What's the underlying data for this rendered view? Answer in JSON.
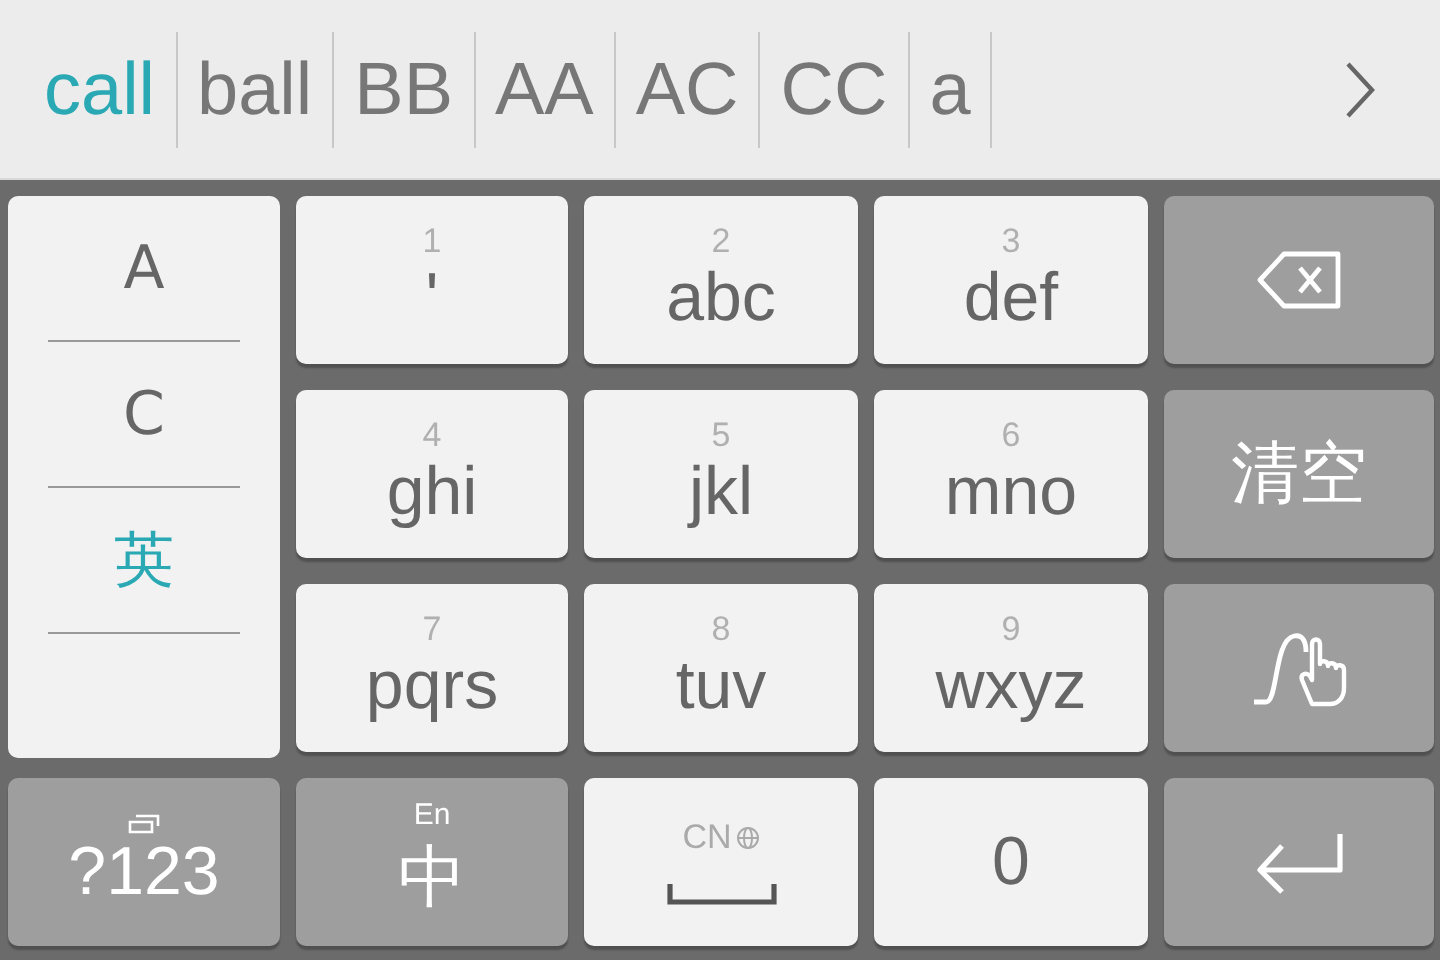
{
  "candidates": [
    {
      "text": "call",
      "selected": true
    },
    {
      "text": "ball",
      "selected": false
    },
    {
      "text": "BB",
      "selected": false
    },
    {
      "text": "AA",
      "selected": false
    },
    {
      "text": "AC",
      "selected": false
    },
    {
      "text": "CC",
      "selected": false
    },
    {
      "text": "a",
      "selected": false
    }
  ],
  "side_panel": [
    {
      "label": "A",
      "selected": false
    },
    {
      "label": "C",
      "selected": false
    },
    {
      "label": "英",
      "selected": true
    }
  ],
  "keys": [
    {
      "kind": "digit",
      "hint": "1",
      "label": "'"
    },
    {
      "kind": "digit",
      "hint": "2",
      "label": "abc"
    },
    {
      "kind": "digit",
      "hint": "3",
      "label": "def"
    },
    {
      "kind": "backspace"
    },
    {
      "kind": "digit",
      "hint": "4",
      "label": "ghi"
    },
    {
      "kind": "digit",
      "hint": "5",
      "label": "jkl"
    },
    {
      "kind": "digit",
      "hint": "6",
      "label": "mno"
    },
    {
      "kind": "clear",
      "label": "清空"
    },
    {
      "kind": "digit",
      "hint": "7",
      "label": "pqrs"
    },
    {
      "kind": "digit",
      "hint": "8",
      "label": "tuv"
    },
    {
      "kind": "digit",
      "hint": "9",
      "label": "wxyz"
    },
    {
      "kind": "gesture"
    },
    {
      "kind": "symbols",
      "label": "?123"
    },
    {
      "kind": "language",
      "hint": "En",
      "label": "中"
    },
    {
      "kind": "space",
      "hint": "CN"
    },
    {
      "kind": "zero",
      "label": "0"
    },
    {
      "kind": "enter"
    }
  ]
}
